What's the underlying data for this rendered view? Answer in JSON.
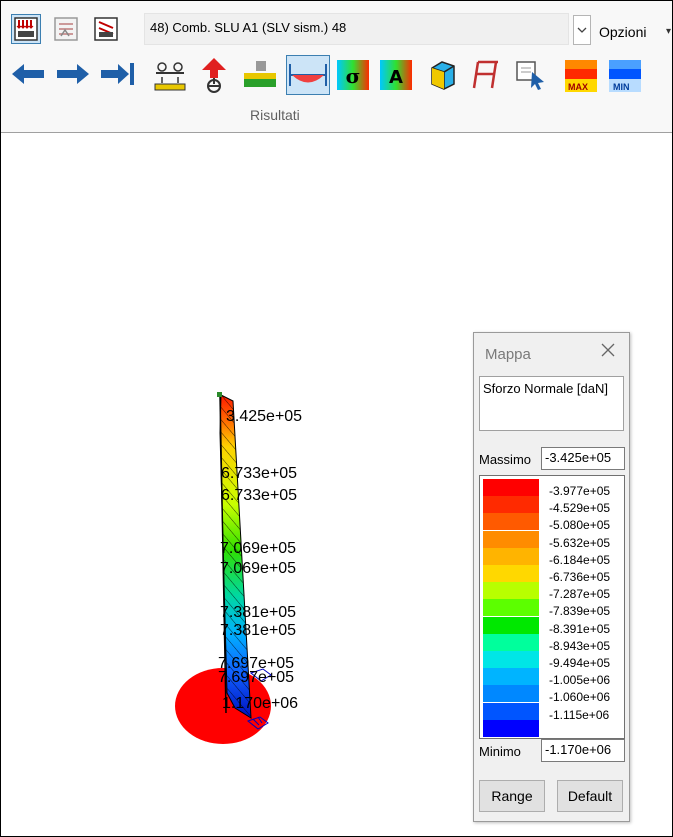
{
  "toolbar": {
    "combo_value": "48) Comb. SLU A1 (SLV sism.) 48",
    "options_label": "Opzioni",
    "group_label": "Risultati",
    "icons": [
      "loads-view-icon",
      "structure-view-icon",
      "deformed-view-icon",
      "arrow-left-icon",
      "arrow-right-icon",
      "arrow-end-icon",
      "supports-icon",
      "reactions-icon",
      "beam-stress-icon",
      "diagram-icon",
      "sigma-map-icon",
      "area-map-icon",
      "solid-view-icon",
      "section-icon",
      "query-icon",
      "max-map-icon",
      "min-map-icon"
    ],
    "max_badge": "MAX",
    "min_badge": "MIN"
  },
  "legend": {
    "title": "Mappa",
    "quantity": "Sforzo Normale [daN]",
    "max_label": "Massimo",
    "max_value": "-3.425e+05",
    "min_label": "Minimo",
    "min_value": "-1.170e+06",
    "range_button": "Range",
    "default_button": "Default",
    "ticks": [
      "-3.977e+05",
      "-4.529e+05",
      "-5.080e+05",
      "-5.632e+05",
      "-6.184e+05",
      "-6.736e+05",
      "-7.287e+05",
      "-7.839e+05",
      "-8.391e+05",
      "-8.943e+05",
      "-9.494e+05",
      "-1.005e+06",
      "-1.060e+06",
      "-1.115e+06"
    ],
    "colors": [
      "#ff0000",
      "#ff2a00",
      "#ff5a00",
      "#ff8c00",
      "#ffb400",
      "#ffd800",
      "#b8ff00",
      "#5cff00",
      "#00e800",
      "#00ff9c",
      "#00e6e6",
      "#00b4ff",
      "#0088ff",
      "#0055ff",
      "#0000ff"
    ]
  },
  "plot": {
    "labels": [
      "3.425e+05",
      "6.733e+05",
      "6.733e+05",
      "7.069e+05",
      "7.069e+05",
      "7.381e+05",
      "7.381e+05",
      "7.697e+05",
      "7.697e+05",
      "1.170e+06"
    ]
  }
}
